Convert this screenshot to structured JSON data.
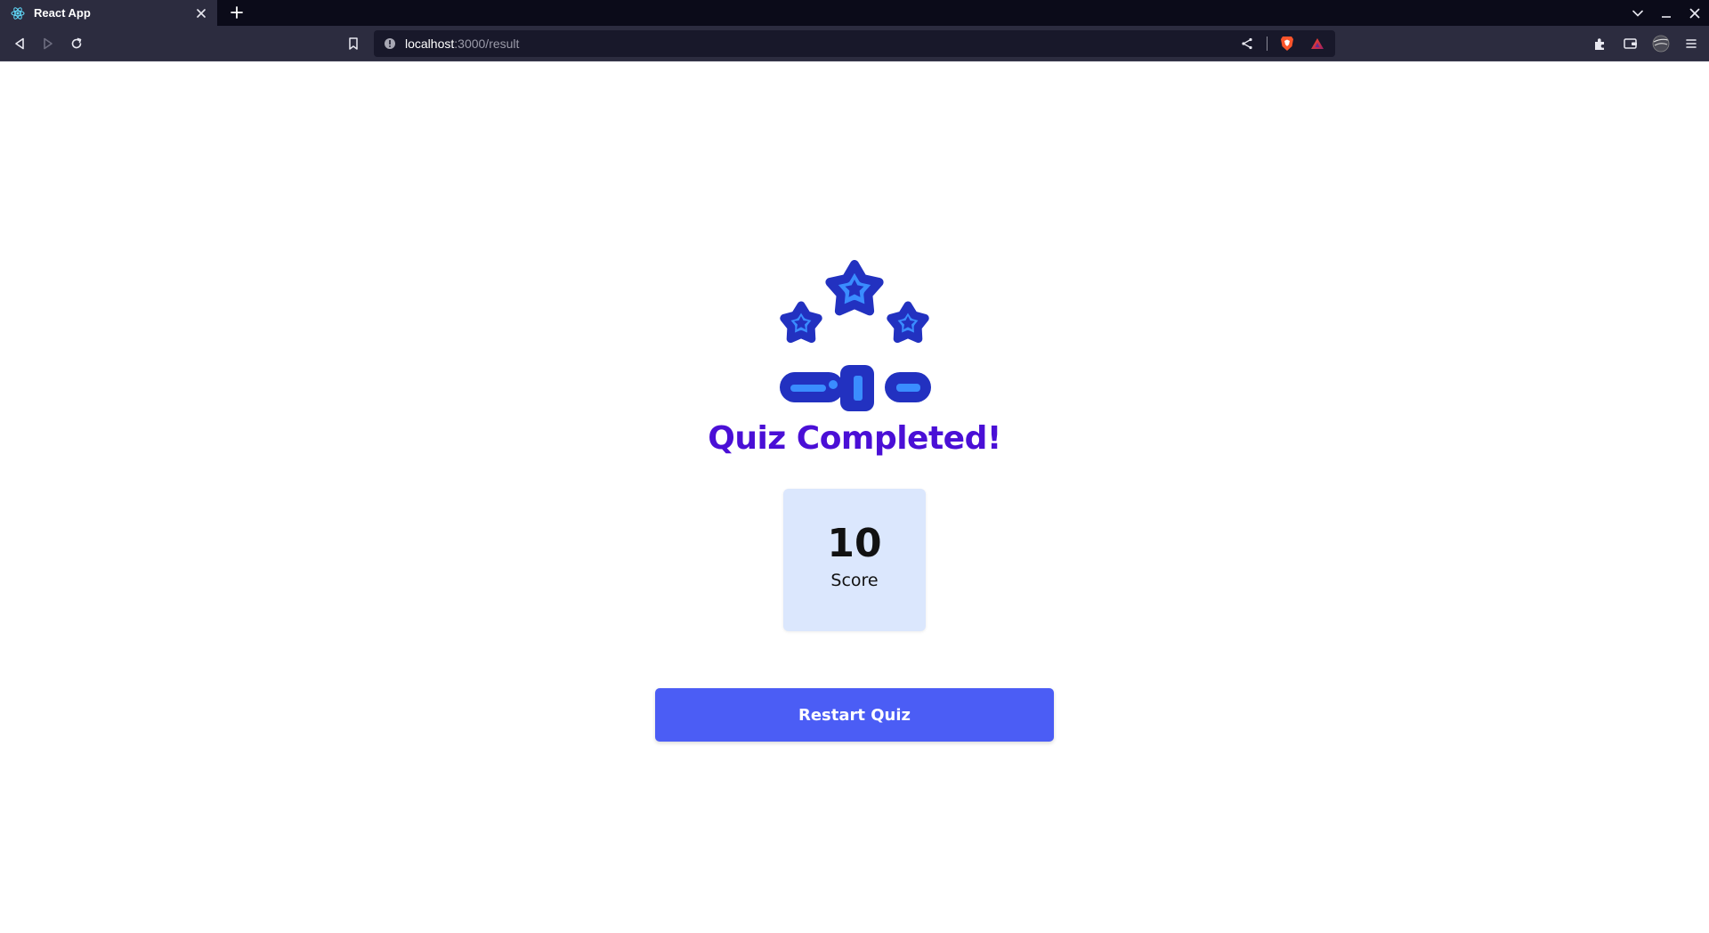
{
  "browser": {
    "tab": {
      "title": "React App",
      "favicon": "react-icon",
      "close_icon": "close-icon"
    },
    "new_tab_icon": "plus-icon",
    "window_controls": [
      "chevron-down-icon",
      "minimize-icon",
      "close-icon"
    ],
    "nav": {
      "back_icon": "back-icon",
      "forward_icon": "forward-icon",
      "reload_icon": "reload-icon"
    },
    "bookmark_icon": "bookmark-icon",
    "address": {
      "host": "localhost",
      "rest": ":3000/result",
      "info_icon": "info-icon"
    },
    "address_actions": [
      "share-icon",
      "brave-shields-icon",
      "brave-rewards-icon"
    ],
    "toolbar_actions": [
      "extensions-icon",
      "wallet-icon",
      "profile-avatar",
      "menu-icon"
    ]
  },
  "page": {
    "illustration": "trophy-stars-icon",
    "title": "Quiz Completed!",
    "score": {
      "value": "10",
      "label": "Score"
    },
    "restart_label": "Restart Quiz"
  },
  "colors": {
    "title": "#4a0fd6",
    "score_card": "#dbe7fd",
    "button": "#4b5df5",
    "icon_dark": "#2231c0",
    "icon_light": "#3a8dff",
    "chrome_bg": "#2c2c3f",
    "tabstrip_bg": "#0b0b19"
  }
}
